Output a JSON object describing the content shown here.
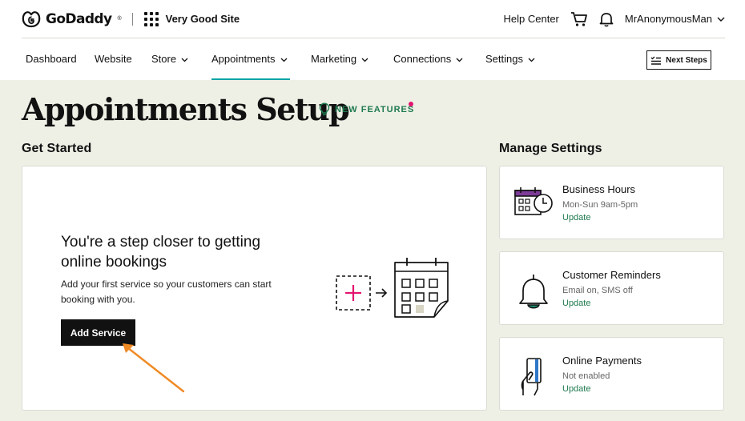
{
  "header": {
    "brand": "GoDaddy",
    "site_name": "Very Good Site",
    "help_center": "Help Center",
    "user_name": "MrAnonymousMan"
  },
  "nav": {
    "items": [
      {
        "label": "Dashboard",
        "has_dropdown": false,
        "active": false
      },
      {
        "label": "Website",
        "has_dropdown": false,
        "active": false
      },
      {
        "label": "Store",
        "has_dropdown": true,
        "active": false
      },
      {
        "label": "Appointments",
        "has_dropdown": true,
        "active": true
      },
      {
        "label": "Marketing",
        "has_dropdown": true,
        "active": false
      },
      {
        "label": "Connections",
        "has_dropdown": true,
        "active": false
      },
      {
        "label": "Settings",
        "has_dropdown": true,
        "active": false
      }
    ],
    "next_steps": "Next Steps"
  },
  "page": {
    "title": "Appointments Setup",
    "new_features": "NEW FEATURES"
  },
  "get_started": {
    "title": "Get Started",
    "heading": "You're a step closer to getting online bookings",
    "description": "Add your first service so your customers can start booking with you.",
    "button": "Add Service"
  },
  "manage_settings": {
    "title": "Manage Settings",
    "items": [
      {
        "title": "Business Hours",
        "subtitle": "Mon-Sun 9am-5pm",
        "link": "Update",
        "icon": "calendar-clock-icon"
      },
      {
        "title": "Customer Reminders",
        "subtitle": "Email on, SMS off",
        "link": "Update",
        "icon": "bell-icon"
      },
      {
        "title": "Online Payments",
        "subtitle": "Not enabled",
        "link": "Update",
        "icon": "card-hand-icon"
      }
    ]
  },
  "colors": {
    "page_bg": "#eef0e6",
    "accent_green": "#1f7a4f",
    "active_tab": "#00a4a6",
    "pink": "#e3156f",
    "annotation_arrow": "#f08a24"
  }
}
